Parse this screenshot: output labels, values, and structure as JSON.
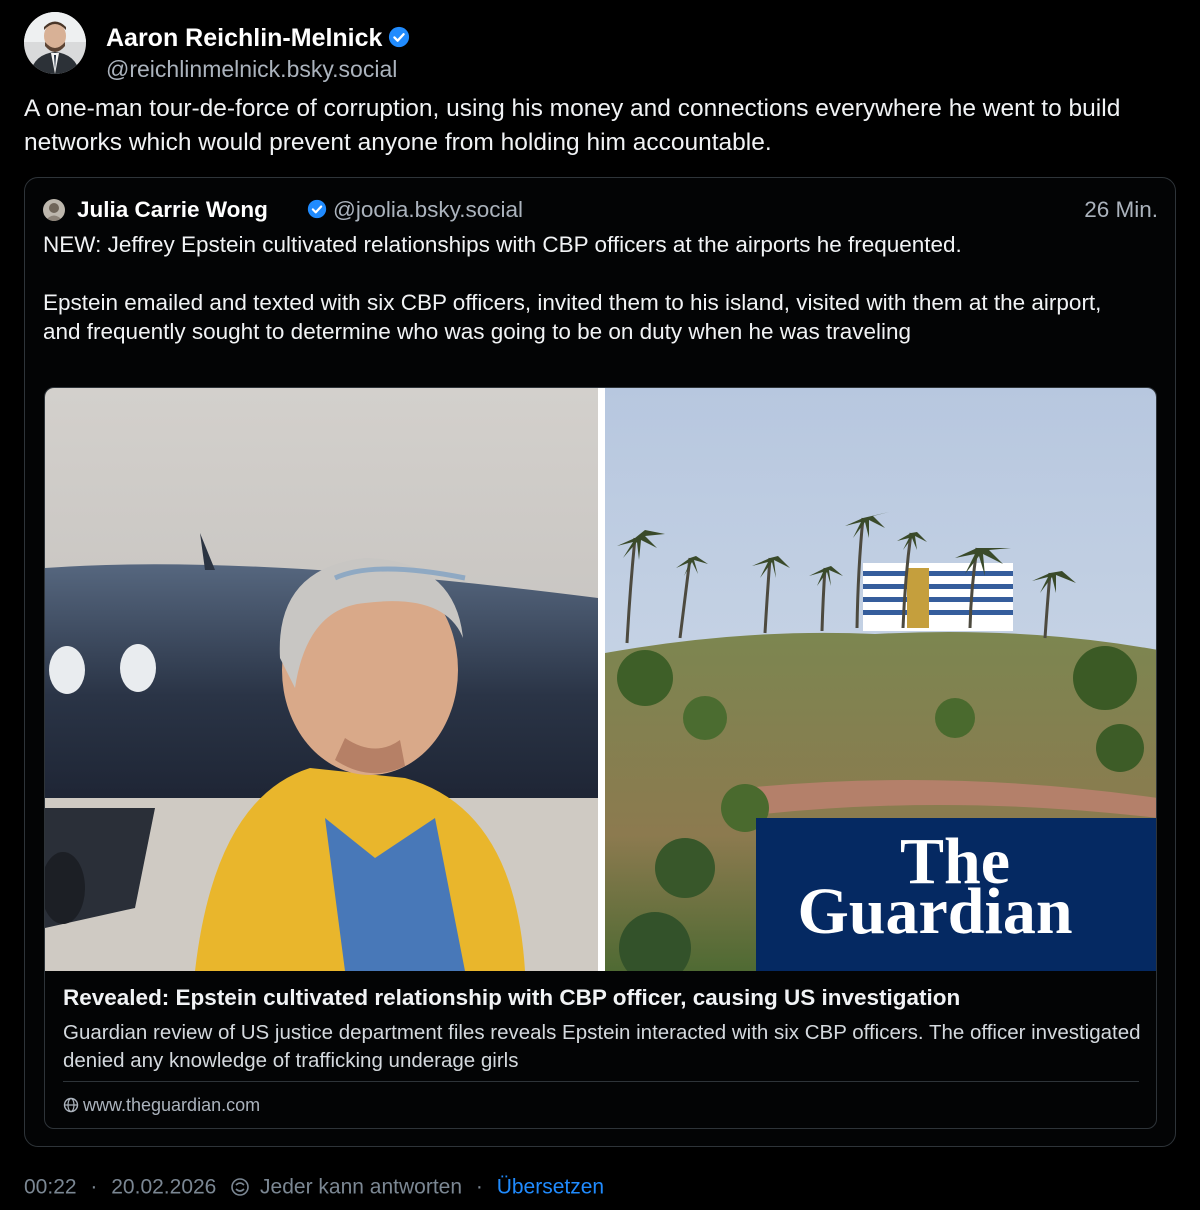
{
  "author": {
    "name": "Aaron Reichlin-Melnick",
    "handle": "@reichlinmelnick.bsky.social",
    "verified": true
  },
  "post": {
    "text": "A one-man tour-de-force of corruption, using his money and connections everywhere he went to build networks which would prevent anyone from holding him accountable."
  },
  "quote": {
    "name": "Julia Carrie Wong",
    "handle": "@joolia.bsky.social",
    "verified": true,
    "time": "26 Min.",
    "text": "NEW: Jeffrey Epstein cultivated relationships with CBP officers at the airports he frequented.\n\nEpstein emailed and texted with six CBP officers, invited them to his island, visited with them at the airport, and frequently sought to determine who was going to be on duty when he was traveling"
  },
  "link_card": {
    "image_logo_text": [
      "The",
      "Guardian"
    ],
    "title": "Revealed: Epstein cultivated relationship with CBP officer, causing US investigation",
    "description": "Guardian review of US justice department files reveals Epstein interacted with six CBP officers. The officer investigated denied any knowledge of trafficking underage girls",
    "domain": "www.theguardian.com"
  },
  "meta": {
    "time": "00:22",
    "date": "20.02.2026",
    "separator": "·",
    "reply_setting": "Jeder kann antworten",
    "translate": "Übersetzen"
  },
  "colors": {
    "background": "#000000",
    "accent": "#208bfe",
    "muted": "#abb3bd",
    "border": "#2e3439",
    "guardian_blue": "#052962"
  }
}
